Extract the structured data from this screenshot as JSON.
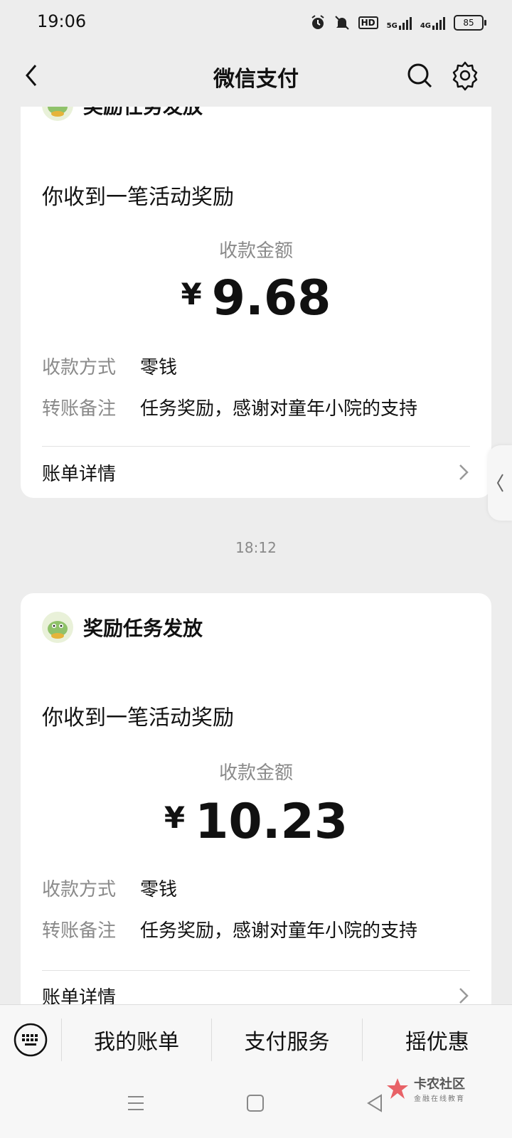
{
  "status": {
    "time": "19:06",
    "network_5g": "5G",
    "network_4g": "4G",
    "hd": "HD",
    "battery": "85"
  },
  "nav": {
    "title": "微信支付"
  },
  "cards": [
    {
      "sender": "奖励任务发放",
      "headline": "你收到一笔活动奖励",
      "amount_label": "收款金额",
      "currency": "¥",
      "amount": "9.68",
      "method_key": "收款方式",
      "method_value": "零钱",
      "note_key": "转账备注",
      "note_value": "任务奖励，感谢对童年小院的支持",
      "detail_label": "账单详情"
    },
    {
      "sender": "奖励任务发放",
      "headline": "你收到一笔活动奖励",
      "amount_label": "收款金额",
      "currency": "¥",
      "amount": "10.23",
      "method_key": "收款方式",
      "method_value": "零钱",
      "note_key": "转账备注",
      "note_value": "任务奖励，感谢对童年小院的支持",
      "detail_label": "账单详情"
    }
  ],
  "timestamp": "18:12",
  "bottom_menu": {
    "items": [
      "我的账单",
      "支付服务",
      "摇优惠"
    ]
  },
  "watermark": {
    "title": "卡农社区",
    "subtitle": "金融在线教育"
  },
  "colors": {
    "background": "#ededed",
    "card": "#ffffff",
    "muted_text": "#8a8a8a",
    "watermark_red": "#e5484d"
  }
}
